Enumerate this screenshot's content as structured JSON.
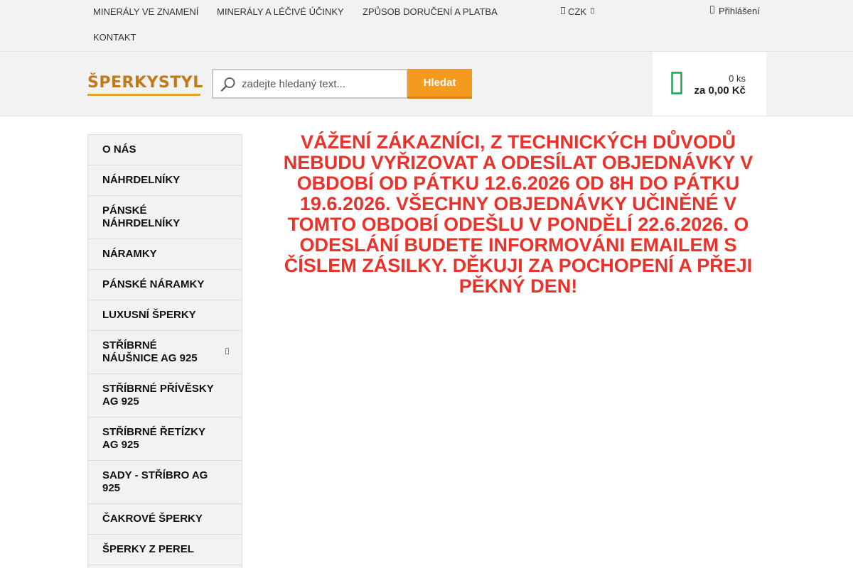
{
  "topnav": {
    "links": [
      "MINERÁLY VE ZNAMENÍ",
      "MINERÁLY A LÉČIVÉ ÚČINKY",
      "ZPŮSOB DORUČENÍ A PLATBA",
      "KONTAKT"
    ],
    "currency": "CZK",
    "login": "Přihlášení"
  },
  "header": {
    "logo_text": "ŠPERKYSTYL",
    "search": {
      "placeholder": "zadejte hledaný text...",
      "button": "Hledat"
    },
    "cart": {
      "qty": "0 ks",
      "total": "za 0,00 Kč"
    }
  },
  "sidebar": {
    "items": [
      "O NÁS",
      "NÁHRDELNÍKY",
      "PÁNSKÉ NÁHRDELNÍKY",
      "NÁRAMKY",
      "PÁNSKÉ NÁRAMKY",
      "LUXUSNÍ ŠPERKY",
      "STŘÍBRNÉ NÁUŠNICE AG 925",
      "STŘÍBRNÉ PŘÍVĚSKY AG 925",
      "STŘÍBRNÉ ŘETÍZKY AG 925",
      "SADY - STŘÍBRO AG 925",
      "ČAKROVÉ ŠPERKY",
      "ŠPERKY Z PEREL"
    ]
  },
  "notice": "VÁŽENÍ ZÁKAZNÍCI, Z TECHNICKÝCH DŮVODŮ NEBUDU VYŘIZOVAT A ODESÍLAT OBJEDNÁVKY V OBDOBÍ OD PÁTKU 12.6.2026  OD 8H DO PÁTKU 19.6.2026. VŠECHNY OBJEDNÁVKY UČINĚNÉ V TOMTO OBDOBÍ ODEŠLU V PONDĚLÍ 22.6.2026. O ODESLÁNÍ BUDETE INFORMOVÁNI EMAILEM S ČÍSLEM ZÁSILKY. DĚKUJI ZA POCHOPENÍ A PŘEJI PĚKNÝ DEN!",
  "colors": {
    "accent": "#f49a1e",
    "notice": "#e8322a",
    "cart_icon": "#22a05a"
  },
  "icons": {
    "search": "magnifier-icon",
    "cart": "shopping-cart-icon",
    "login": "user-icon",
    "currency": "currency-icon"
  }
}
